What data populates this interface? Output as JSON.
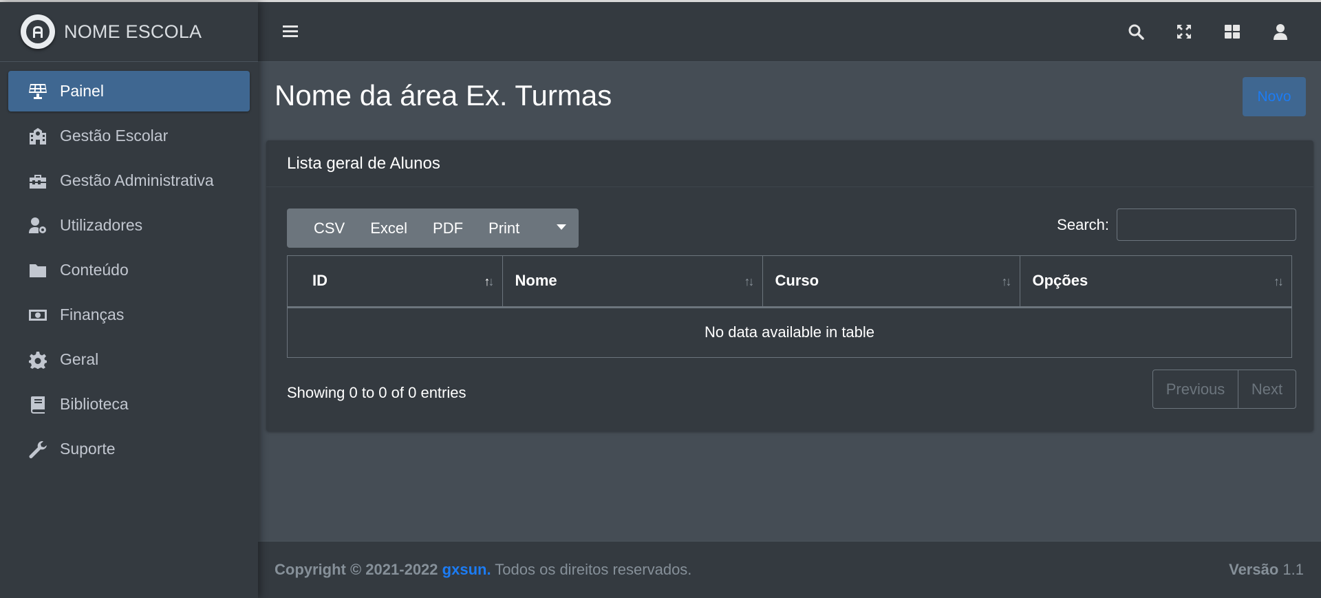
{
  "brand": {
    "name": "NOME ESCOLA",
    "logo_icon": "school-logo-icon"
  },
  "sidebar": {
    "items": [
      {
        "label": "Painel",
        "icon": "solar-panel-icon",
        "active": true
      },
      {
        "label": "Gestão Escolar",
        "icon": "school-icon"
      },
      {
        "label": "Gestão Administrativa",
        "icon": "toolbox-icon"
      },
      {
        "label": "Utilizadores",
        "icon": "user-cog-icon"
      },
      {
        "label": "Conteúdo",
        "icon": "folder-icon"
      },
      {
        "label": "Finanças",
        "icon": "money-bill-icon"
      },
      {
        "label": "Geral",
        "icon": "gear-icon"
      },
      {
        "label": "Biblioteca",
        "icon": "book-icon"
      },
      {
        "label": "Suporte",
        "icon": "wrench-icon"
      }
    ]
  },
  "topbar": {
    "icons": [
      "search-icon",
      "fullscreen-icon",
      "grid-icon",
      "user-icon"
    ]
  },
  "page": {
    "title": "Nome da área Ex. Turmas",
    "new_button": "Novo"
  },
  "card": {
    "title": "Lista geral de Alunos",
    "export_buttons": [
      "CSV",
      "Excel",
      "PDF",
      "Print"
    ],
    "search_label": "Search:",
    "search_value": "",
    "columns": [
      "ID",
      "Nome",
      "Curso",
      "Opções"
    ],
    "empty_message": "No data available in table",
    "info": "Showing 0 to 0 of 0 entries",
    "pagination": {
      "previous": "Previous",
      "next": "Next"
    }
  },
  "footer": {
    "copyright_prefix": "Copyright © 2021-2022",
    "author": "gxsun.",
    "rights": "Todos os direitos reservados.",
    "version_label": "Versão",
    "version": "1.1"
  },
  "colors": {
    "sidebar_bg": "#343a40",
    "content_bg": "#454d55",
    "active_item": "#3f6791",
    "link": "#1c7cf4",
    "toolbar_bg": "#6c757d"
  }
}
